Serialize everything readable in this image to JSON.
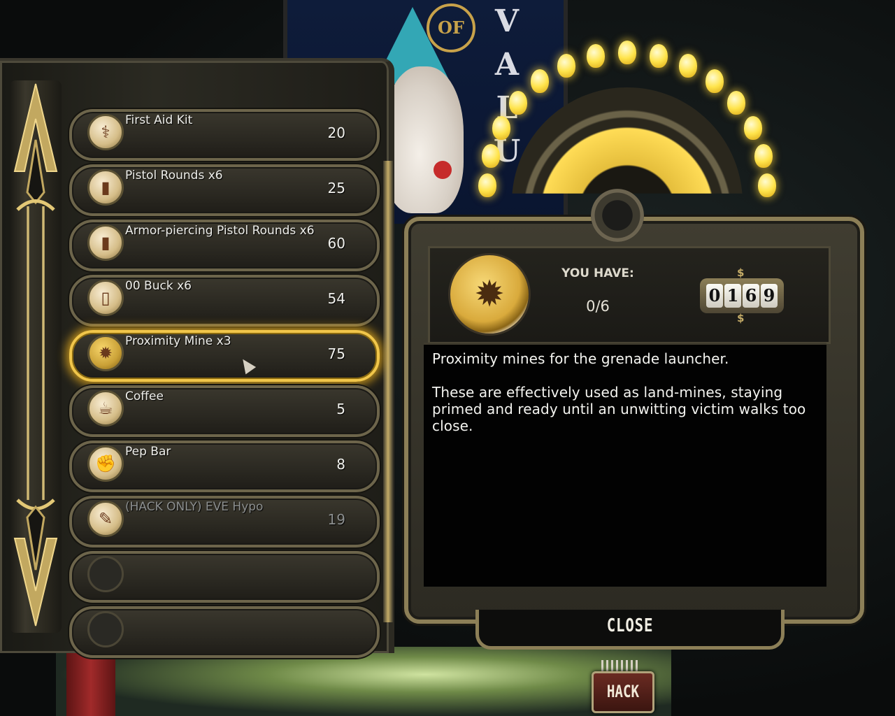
{
  "background": {
    "poster_word": "VALU",
    "poster_badge": "OF"
  },
  "items": [
    {
      "name": "First Aid Kit",
      "price": "20",
      "icon": "caduceus-icon",
      "glyph": "⚕",
      "state": "normal"
    },
    {
      "name": "Pistol Rounds x6",
      "price": "25",
      "icon": "bullet-icon",
      "glyph": "▮",
      "state": "normal"
    },
    {
      "name": "Armor-piercing Pistol Rounds x6",
      "price": "60",
      "icon": "ap-bullet-icon",
      "glyph": "▮",
      "state": "normal"
    },
    {
      "name": "00 Buck x6",
      "price": "54",
      "icon": "shotgun-shell-icon",
      "glyph": "▯",
      "state": "normal"
    },
    {
      "name": "Proximity Mine x3",
      "price": "75",
      "icon": "proximity-mine-icon",
      "glyph": "✹",
      "state": "selected"
    },
    {
      "name": "Coffee",
      "price": "5",
      "icon": "coffee-cup-icon",
      "glyph": "☕",
      "state": "normal"
    },
    {
      "name": "Pep Bar",
      "price": "8",
      "icon": "pep-bar-icon",
      "glyph": "✊",
      "state": "normal"
    },
    {
      "name": "(HACK ONLY) EVE Hypo",
      "price": "19",
      "icon": "eve-hypo-icon",
      "glyph": "✎",
      "state": "disabled"
    },
    {
      "name": "",
      "price": "",
      "icon": "empty-slot-icon",
      "glyph": "",
      "state": "empty"
    },
    {
      "name": "",
      "price": "",
      "icon": "empty-slot-icon",
      "glyph": "",
      "state": "empty"
    }
  ],
  "detail": {
    "icon": "proximity-mine-icon",
    "icon_glyph": "✹",
    "you_have_label": "YOU HAVE:",
    "you_have_value": "0/6",
    "money_digits": [
      "0",
      "1",
      "6",
      "9"
    ],
    "money_symbol": "$",
    "description": "Proximity mines for the grenade launcher.\n\nThese are effectively used as land-mines, staying primed and ready until an unwitting victim walks too close.",
    "close_label": "CLOSE",
    "hack_label": "HACK"
  },
  "colors": {
    "selected_glow": "#f1c64a",
    "frame_brass": "#8c7f57",
    "bulb_yellow": "#ffe44c",
    "disabled_text": "#8c8f8f"
  }
}
